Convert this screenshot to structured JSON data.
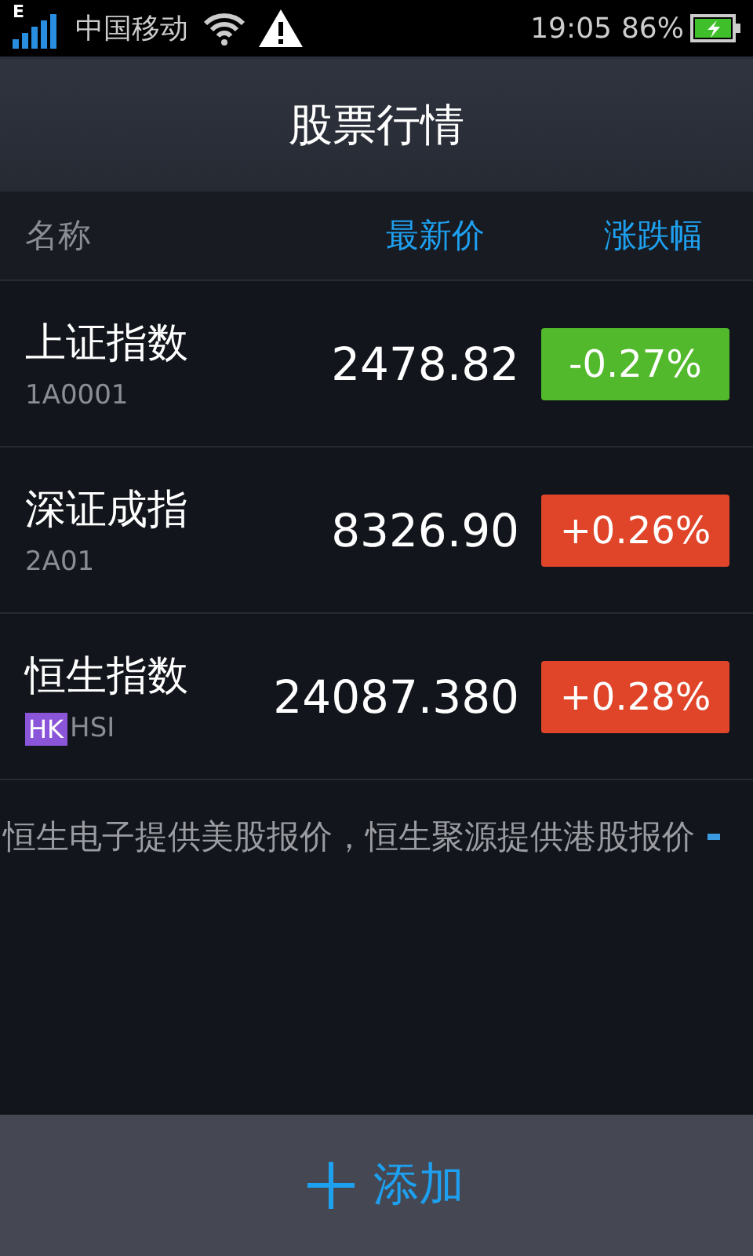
{
  "status_bar": {
    "network_type": "E",
    "carrier": "中国移动",
    "time": "19:05",
    "battery": "86%"
  },
  "title": "股票行情",
  "columns": [
    "名称",
    "最新价",
    "涨跌幅"
  ],
  "stocks": [
    {
      "name": "上证指数",
      "code": "1A0001",
      "price": "2478.82",
      "change": "-0.27%",
      "color": "#52b92c"
    },
    {
      "name": "深证成指",
      "code": "2A01",
      "price": "8326.90",
      "change": "+0.26%",
      "color": "#e0452a"
    },
    {
      "name": "恒生指数",
      "market": "HK",
      "code": "HSI",
      "price": "24087.380",
      "change": "+0.28%",
      "color": "#e0452a"
    }
  ],
  "notice": "恒生电子提供美股报价，恒生聚源提供港股报价",
  "add_button": "添加"
}
